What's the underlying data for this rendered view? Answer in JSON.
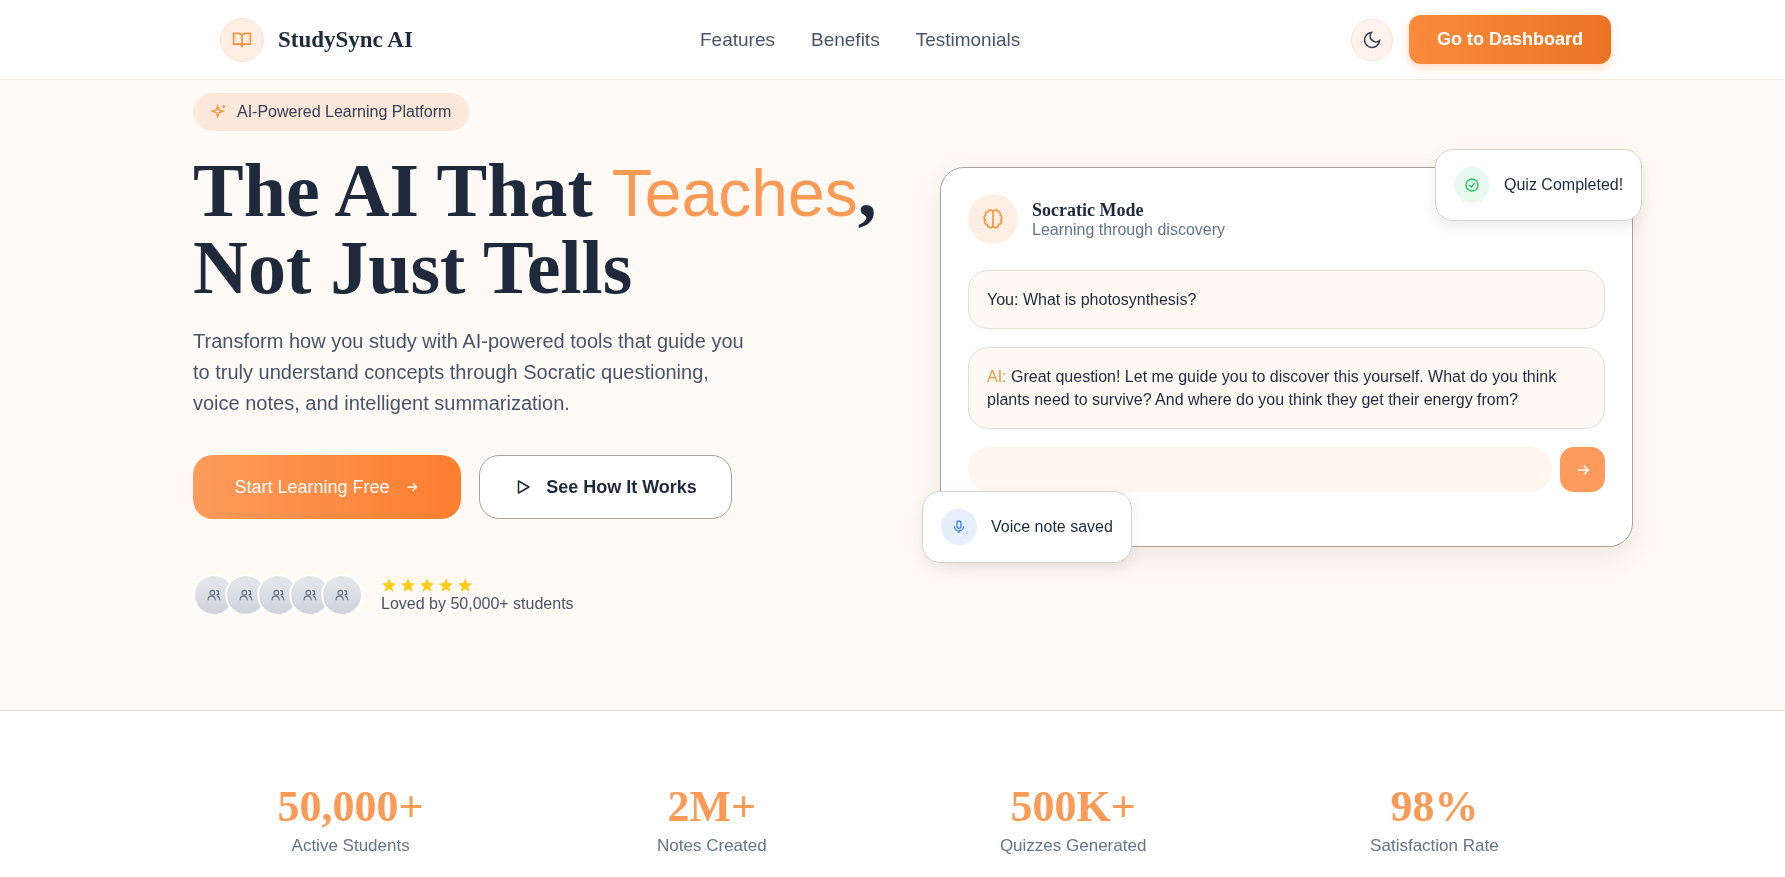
{
  "header": {
    "brand": "StudySync AI",
    "nav": [
      "Features",
      "Benefits",
      "Testimonials"
    ],
    "cta": "Go to Dashboard"
  },
  "hero": {
    "badge": "AI-Powered Learning Platform",
    "headline": {
      "line1_before": "The AI That ",
      "highlight": "Teaches",
      "line1_after": ",",
      "line2": "Not Just Tells"
    },
    "description": "Transform how you study with AI-powered tools that guide you to truly understand concepts through Socratic questioning, voice notes, and intelligent summarization.",
    "buttons": [
      {
        "label": "Start Learning Free",
        "kind": "primary"
      },
      {
        "label": "See How It Works",
        "kind": "secondary"
      }
    ],
    "social_proof": {
      "stars": 5,
      "text": "Loved by 50,000+ students"
    }
  },
  "chat_card": {
    "title": "Socratic Mode",
    "subtitle": "Learning through discovery",
    "messages": [
      {
        "kind": "user",
        "speaker": "You:",
        "text": "What is photosynthesis?"
      },
      {
        "kind": "ai",
        "speaker": "AI:",
        "text": "Great question! Let me guide you to discover this yourself. What do you think plants need to survive? And where do you think they get their energy from?"
      }
    ]
  },
  "toasts": [
    {
      "kind": "quiz",
      "label": "Quiz Completed!"
    },
    {
      "kind": "voice",
      "label": "Voice note saved"
    }
  ],
  "stats": [
    {
      "value": "50,000+",
      "label": "Active Students"
    },
    {
      "value": "2M+",
      "label": "Notes Created"
    },
    {
      "value": "500K+",
      "label": "Quizzes Generated"
    },
    {
      "value": "98%",
      "label": "Satisfaction Rate"
    }
  ]
}
